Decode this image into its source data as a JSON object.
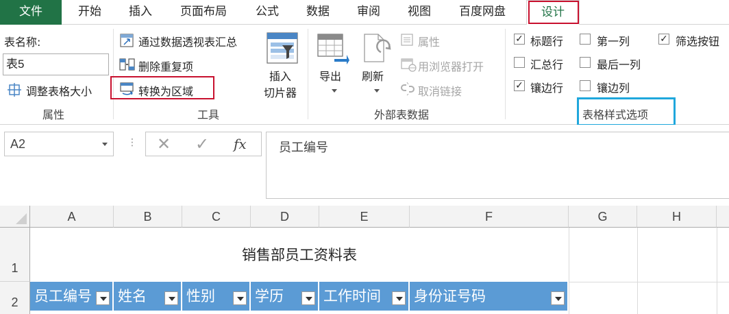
{
  "tabs": [
    {
      "id": "file",
      "label": "文件"
    },
    {
      "id": "home",
      "label": "开始"
    },
    {
      "id": "insert",
      "label": "插入"
    },
    {
      "id": "layout",
      "label": "页面布局"
    },
    {
      "id": "formula",
      "label": "公式"
    },
    {
      "id": "data",
      "label": "数据"
    },
    {
      "id": "review",
      "label": "审阅"
    },
    {
      "id": "view",
      "label": "视图"
    },
    {
      "id": "baidu",
      "label": "百度网盘"
    },
    {
      "id": "design",
      "label": "设计"
    }
  ],
  "ribbon": {
    "properties": {
      "table_name_label": "表名称:",
      "table_name_value": "表5",
      "resize_label": "调整表格大小",
      "group_label": "属性"
    },
    "tools": {
      "pivot_label": "通过数据透视表汇总",
      "dedupe_label": "删除重复项",
      "convert_label": "转换为区域",
      "slicer_label_1": "插入",
      "slicer_label_2": "切片器",
      "group_label": "工具"
    },
    "external": {
      "export_label": "导出",
      "refresh_label": "刷新",
      "properties_label": "属性",
      "open_browser_label": "用浏览器打开",
      "unlink_label": "取消链接",
      "group_label": "外部表数据"
    },
    "style_options": {
      "header_row": {
        "label": "标题行",
        "checked": true
      },
      "total_row": {
        "label": "汇总行",
        "checked": false
      },
      "banded_rows": {
        "label": "镶边行",
        "checked": true
      },
      "first_column": {
        "label": "第一列",
        "checked": false
      },
      "last_column": {
        "label": "最后一列",
        "checked": false
      },
      "banded_columns": {
        "label": "镶边列",
        "checked": false
      },
      "filter_button": {
        "label": "筛选按钮",
        "checked": true
      },
      "group_label": "表格样式选项"
    }
  },
  "formula_bar": {
    "cell_ref": "A2",
    "cancel_glyph": "✕",
    "enter_glyph": "✓",
    "fx_glyph": "fx",
    "content": "员工编号"
  },
  "sheet": {
    "columns": [
      "A",
      "B",
      "C",
      "D",
      "E",
      "F",
      "G",
      "H"
    ],
    "rows": [
      "1",
      "2"
    ],
    "title": "销售部员工资料表",
    "headers": [
      "员工编号",
      "姓名",
      "性别",
      "学历",
      "工作时间",
      "身份证号码"
    ]
  },
  "colors": {
    "file_tab": "#217346",
    "header_fill": "#5b9bd5",
    "highlight_red": "#c8102e",
    "highlight_blue": "#1fa7dc"
  },
  "icons": {
    "resize": "resize-table-icon",
    "pivot": "pivot-summary-icon",
    "dedupe": "remove-duplicates-icon",
    "convert": "convert-to-range-icon",
    "slicer": "insert-slicer-icon",
    "export": "export-icon",
    "refresh": "refresh-icon",
    "properties": "properties-icon",
    "browser": "open-in-browser-icon",
    "unlink": "unlink-icon"
  }
}
